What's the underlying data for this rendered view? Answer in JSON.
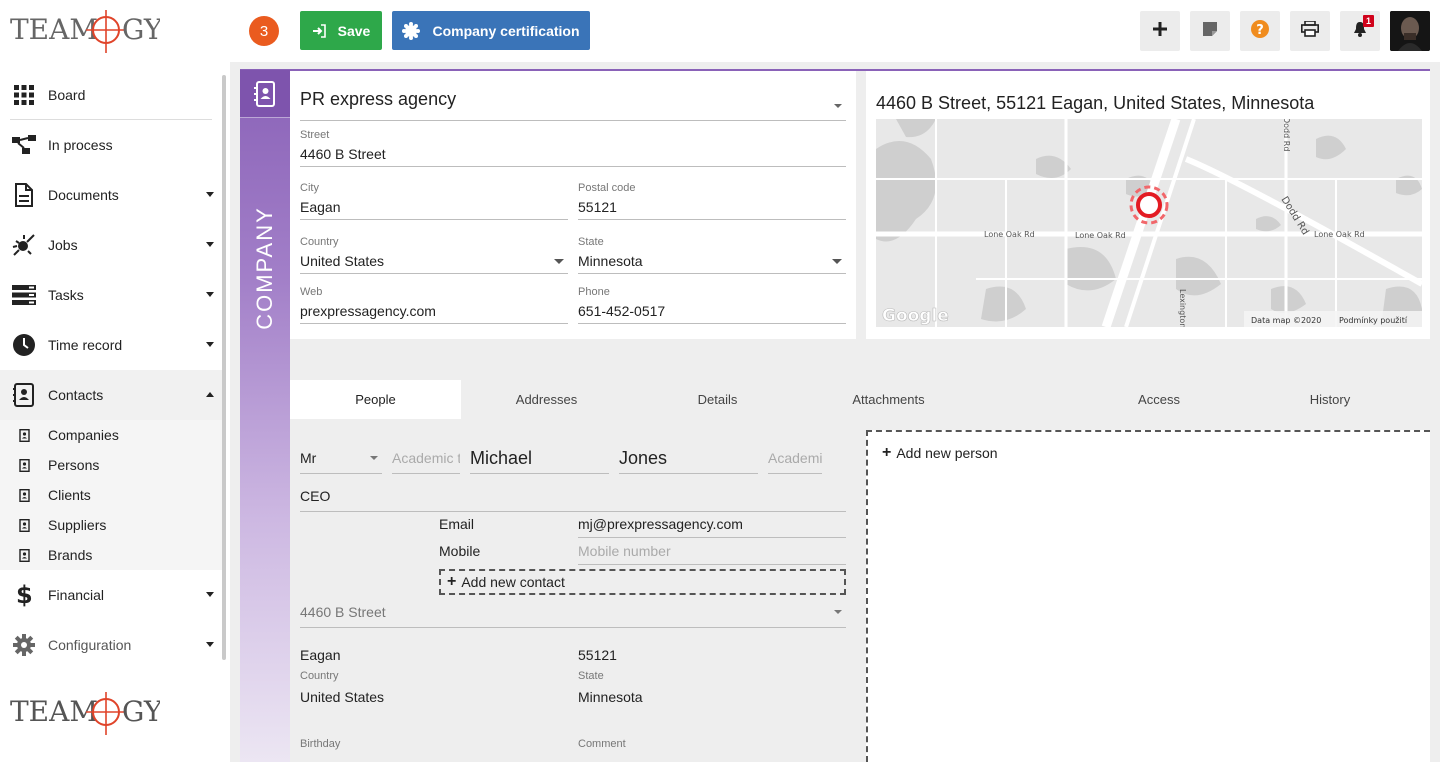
{
  "brand": {
    "logo_text": "TEAMOGY"
  },
  "sidebar": {
    "items": [
      {
        "label": "Board",
        "icon": "grid-icon"
      },
      {
        "label": "In process",
        "icon": "flow-icon"
      },
      {
        "label": "Documents",
        "icon": "document-icon"
      },
      {
        "label": "Jobs",
        "icon": "jobs-icon"
      },
      {
        "label": "Tasks",
        "icon": "tasks-icon"
      },
      {
        "label": "Time record",
        "icon": "clock-icon"
      },
      {
        "label": "Contacts",
        "icon": "contacts-icon"
      },
      {
        "label": "Financial",
        "icon": "dollar-icon"
      },
      {
        "label": "Configuration",
        "icon": "gear-icon"
      }
    ],
    "contacts_sub": [
      {
        "label": "Companies"
      },
      {
        "label": "Persons"
      },
      {
        "label": "Clients"
      },
      {
        "label": "Suppliers"
      },
      {
        "label": "Brands"
      }
    ]
  },
  "toolbar": {
    "count": "3",
    "save_label": "Save",
    "cert_label": "Company certification",
    "notifications": "1"
  },
  "company": {
    "section_label": "COMPANY",
    "name": "PR express agency",
    "street_label": "Street",
    "street": "4460  B Street",
    "city_label": "City",
    "city": "Eagan",
    "postal_label": "Postal code",
    "postal": "55121",
    "country_label": "Country",
    "country": "United States",
    "state_label": "State",
    "state": "Minnesota",
    "web_label": "Web",
    "web": "prexpressagency.com",
    "phone_label": "Phone",
    "phone": "651-452-0517"
  },
  "map": {
    "title": "4460 B Street, 55121 Eagan, United States, Minnesota",
    "roads": [
      "Lone Oak Rd",
      "Lone Oak Rd",
      "Lone Oak Rd",
      "Dodd Rd",
      "Dodd Rd",
      "Lexington"
    ],
    "google": "Google",
    "data_credit": "Data map ©2020",
    "terms": "Podmínky použití"
  },
  "tabs": [
    {
      "label": "People"
    },
    {
      "label": "Addresses"
    },
    {
      "label": "Details"
    },
    {
      "label": "Attachments"
    },
    {
      "label": "Access"
    },
    {
      "label": "History"
    }
  ],
  "person": {
    "title": "Mr",
    "academic_before_ph": "Academic t",
    "first_name": "Michael",
    "last_name": "Jones",
    "academic_after_ph": "Academi",
    "position": "CEO",
    "email_label": "Email",
    "email": "mj@prexpressagency.com",
    "mobile_label": "Mobile",
    "mobile_ph": "Mobile number",
    "add_contact": "Add new contact",
    "address_select": "4460 B Street",
    "city": "Eagan",
    "postal": "55121",
    "country_label": "Country",
    "country": "United States",
    "state_label": "State",
    "state": "Minnesota",
    "birthday_label": "Birthday",
    "comment_label": "Comment"
  },
  "add_person": "Add new person"
}
